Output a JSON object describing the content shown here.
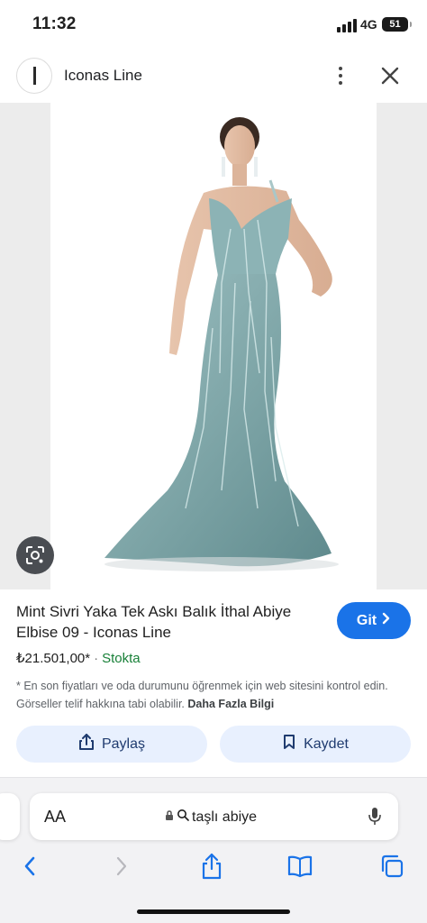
{
  "status_bar": {
    "time": "11:32",
    "network": "4G",
    "battery": "51"
  },
  "header": {
    "site_name": "Iconas Line",
    "logo_letter": "I",
    "icons": [
      "more-vertical-icon",
      "close-icon"
    ]
  },
  "image": {
    "dress_color": "#7fa6a8",
    "background": "#ececec",
    "lens_icon": "google-lens-icon"
  },
  "product": {
    "title": "Mint Sivri Yaka Tek Askı Balık İthal Abiye Elbise 09 - Iconas Line",
    "price": "₺21.501,00*",
    "separator": "·",
    "stock": "Stokta",
    "disclaimer": "* En son fiyatları ve oda durumunu öğrenmek için web sitesini kontrol edin. Görseller telif hakkına tabi olabilir.",
    "more_info_link": "Daha Fazla Bilgi",
    "go_button": "Git",
    "share_button": "Paylaş",
    "save_button": "Kaydet"
  },
  "safari": {
    "aa_label": "AA",
    "search_text": "taşlı abiye",
    "toolbar_icons": [
      "back-icon",
      "forward-icon",
      "share-icon",
      "bookmarks-icon",
      "tabs-icon"
    ]
  },
  "colors": {
    "accent_blue": "#1a73e8",
    "stock_green": "#188038",
    "action_bg": "#e8f0fe"
  }
}
